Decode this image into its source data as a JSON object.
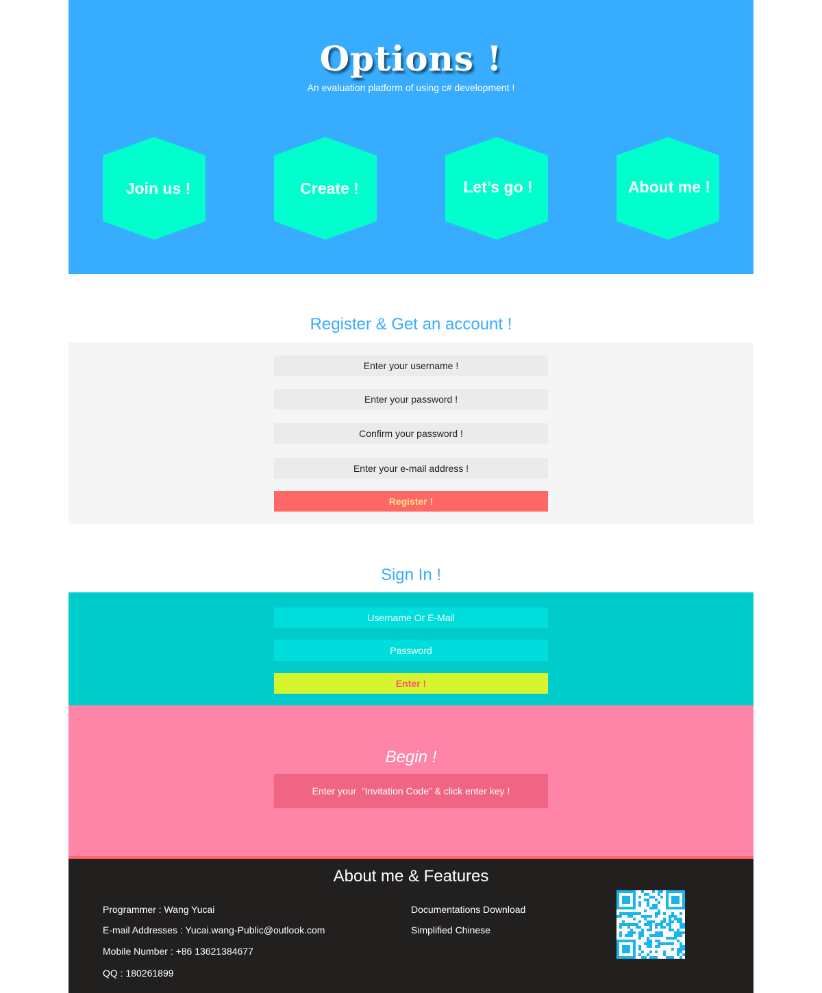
{
  "colors": {
    "hero_bg": "#38adff",
    "hex_bg": "#00ffcc",
    "register_panel_bg": "#f5f5f5",
    "register_field_bg": "#ebebeb",
    "register_button_bg": "#ff6666",
    "register_button_text": "#ffe28a",
    "heading_blue": "#38adff",
    "signin_bg": "#00cccc",
    "signin_field_bg": "#00dddd",
    "enter_button_bg": "#d6f52e",
    "enter_button_text": "#ff5577",
    "begin_bg": "#ff85a8",
    "invite_field_bg": "#f06484",
    "footer_bg": "#221f1f",
    "footer_line": "#ff6666",
    "qr_color": "#1ab4ef"
  },
  "hero": {
    "title": "Options !",
    "subtitle": "An evaluation platform of using c# development !",
    "buttons": [
      {
        "label": "Join us !"
      },
      {
        "label": "Create !"
      },
      {
        "label": "Let’s go !"
      },
      {
        "label": "About me !"
      }
    ]
  },
  "register": {
    "title": "Register & Get an account !",
    "username_placeholder": "Enter your username !",
    "password_placeholder": "Enter your password !",
    "confirm_placeholder": "Confirm your password !",
    "email_placeholder": "Enter your e-mail address !",
    "submit_label": "Register !"
  },
  "signin": {
    "title": "Sign In !",
    "username_placeholder": "Username Or E-Mail",
    "password_placeholder": "Password",
    "submit_label": "Enter !"
  },
  "begin": {
    "title": "Begin !",
    "invite_placeholder": "Enter your  “Invitation Code” & click enter key !"
  },
  "footer": {
    "title": "About me & Features",
    "programmer": "Programmer : Wang Yucai",
    "email": "E-mail Addresses : Yucai.wang-Public@outlook.com",
    "mobile": "Mobile Number : +86 13621384677",
    "qq": "QQ : 180261899",
    "docs_link": "Documentations Download",
    "language_link": "Simplified Chinese",
    "qr_icon": "qr-code-icon"
  }
}
